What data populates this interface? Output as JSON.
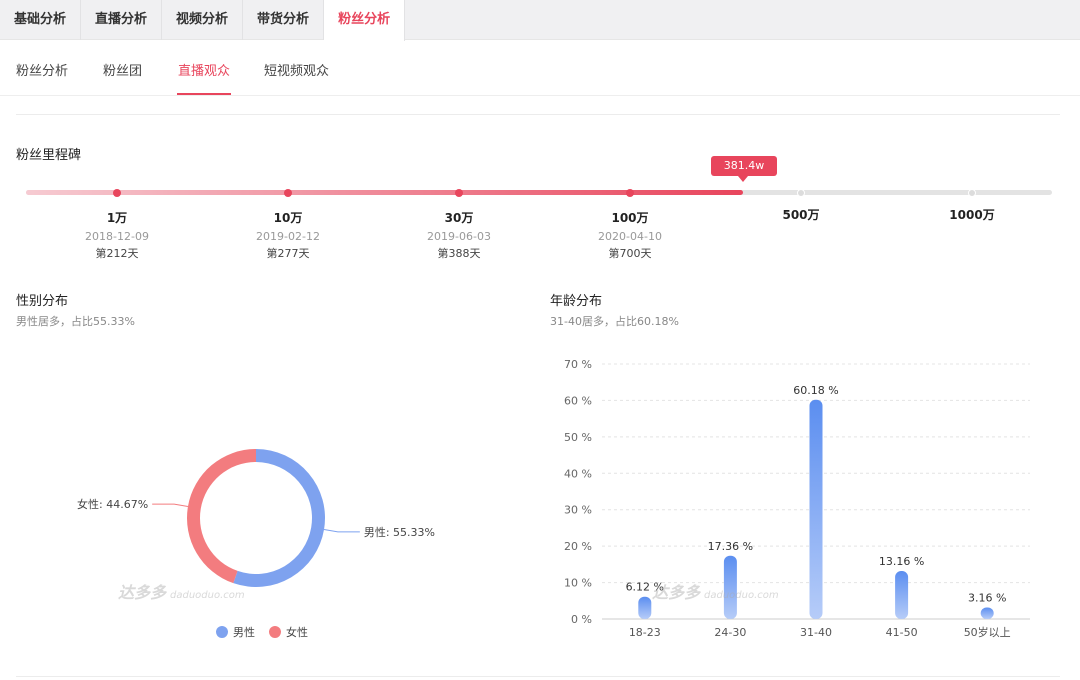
{
  "top_tabs": [
    {
      "label": "基础分析",
      "active": false
    },
    {
      "label": "直播分析",
      "active": false
    },
    {
      "label": "视频分析",
      "active": false
    },
    {
      "label": "带货分析",
      "active": false
    },
    {
      "label": "粉丝分析",
      "active": true
    }
  ],
  "sub_tabs": [
    {
      "label": "粉丝分析",
      "active": false
    },
    {
      "label": "粉丝团",
      "active": false
    },
    {
      "label": "直播观众",
      "active": true
    },
    {
      "label": "短视频观众",
      "active": false
    }
  ],
  "milestone": {
    "title": "粉丝里程碑",
    "current_label": "381.4w",
    "current_value": 381.4,
    "items": [
      {
        "amount": "1万",
        "date": "2018-12-09",
        "days": "第212天",
        "reached": true
      },
      {
        "amount": "10万",
        "date": "2019-02-12",
        "days": "第277天",
        "reached": true
      },
      {
        "amount": "30万",
        "date": "2019-06-03",
        "days": "第388天",
        "reached": true
      },
      {
        "amount": "100万",
        "date": "2020-04-10",
        "days": "第700天",
        "reached": true
      },
      {
        "amount": "500万",
        "date": "",
        "days": "",
        "reached": false
      },
      {
        "amount": "1000万",
        "date": "",
        "days": "",
        "reached": false
      }
    ]
  },
  "gender": {
    "title": "性别分布",
    "subtitle": "男性居多，占比55.33%",
    "legend": [
      "男性",
      "女性"
    ]
  },
  "age": {
    "title": "年龄分布",
    "subtitle": "31-40居多，占比60.18%"
  },
  "watermark": {
    "text": "达多多",
    "domain": "daduoduo.com"
  },
  "colors": {
    "male": "#7ea2ef",
    "female": "#f37c7f",
    "accent": "#e8455c",
    "bar_top": "#5b8ef0",
    "bar_bottom": "#b6ccf8"
  },
  "chart_data": [
    {
      "type": "pie",
      "variant": "donut",
      "categories": [
        "男性",
        "女性"
      ],
      "values": [
        55.33,
        44.67
      ],
      "slice_labels": [
        "男性: 55.33%",
        "女性: 44.67%"
      ],
      "legend": "bottom"
    },
    {
      "type": "bar",
      "categories": [
        "18-23",
        "24-30",
        "31-40",
        "41-50",
        "50岁以上"
      ],
      "values": [
        6.12,
        17.36,
        60.18,
        13.16,
        3.16
      ],
      "data_labels": [
        "6.12 %",
        "17.36 %",
        "60.18 %",
        "13.16 %",
        "3.16 %"
      ],
      "ylim": [
        0,
        70
      ],
      "yticks": [
        0,
        10,
        20,
        30,
        40,
        50,
        60,
        70
      ],
      "ytick_labels": [
        "0 %",
        "10 %",
        "20 %",
        "30 %",
        "40 %",
        "50 %",
        "60 %",
        "70 %"
      ],
      "grid": true
    }
  ]
}
